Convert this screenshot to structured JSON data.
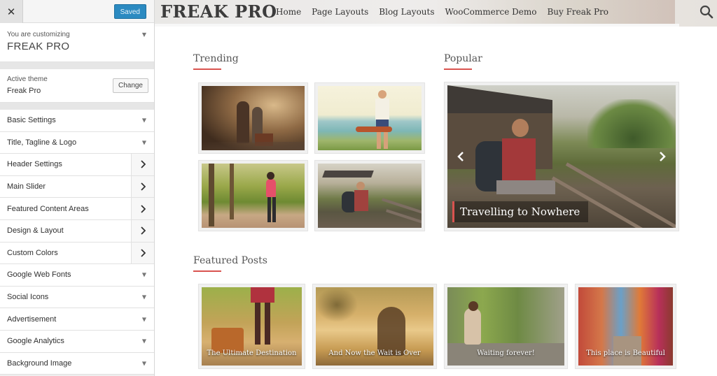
{
  "customizer": {
    "saved_label": "Saved",
    "close_glyph": "✕",
    "customizing_label": "You are customizing",
    "site_name": "FREAK PRO",
    "active_theme_label": "Active theme",
    "active_theme_name": "Freak Pro",
    "change_label": "Change",
    "sections": [
      {
        "label": "Basic Settings",
        "type": "caret"
      },
      {
        "label": "Title, Tagline & Logo",
        "type": "caret"
      },
      {
        "label": "Header Settings",
        "type": "chevron"
      },
      {
        "label": "Main Slider",
        "type": "chevron"
      },
      {
        "label": "Featured Content Areas",
        "type": "chevron"
      },
      {
        "label": "Design & Layout",
        "type": "chevron"
      },
      {
        "label": "Custom Colors",
        "type": "chevron"
      },
      {
        "label": "Google Web Fonts",
        "type": "caret"
      },
      {
        "label": "Social Icons",
        "type": "caret"
      },
      {
        "label": "Advertisement",
        "type": "caret"
      },
      {
        "label": "Google Analytics",
        "type": "caret"
      },
      {
        "label": "Background Image",
        "type": "caret"
      }
    ]
  },
  "site": {
    "logo": "FREAK PRO",
    "nav": [
      "Home",
      "Page Layouts",
      "Blog Layouts",
      "WooCommerce Demo",
      "Buy Freak Pro"
    ],
    "trending_title": "Trending",
    "popular_title": "Popular",
    "featured_title": "Featured Posts",
    "slider_caption": "Travelling to Nowhere",
    "featured_posts": [
      {
        "caption": "The Ultimate Destination"
      },
      {
        "caption": "And Now the Wait is Over"
      },
      {
        "caption": "Waiting forever!"
      },
      {
        "caption": "This place is Beautiful"
      }
    ],
    "accent_color": "#d9534f"
  }
}
